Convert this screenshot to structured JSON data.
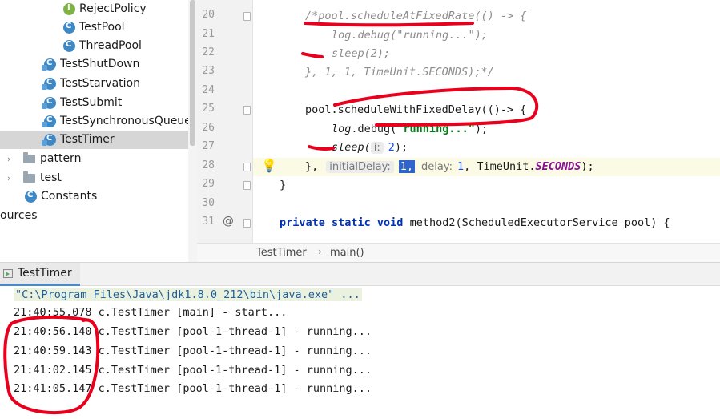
{
  "tree": {
    "items": [
      {
        "label": "RejectPolicy",
        "kind": "iface"
      },
      {
        "label": "TestPool",
        "kind": "class"
      },
      {
        "label": "ThreadPool",
        "kind": "class"
      },
      {
        "label": "TestShutDown",
        "kind": "class"
      },
      {
        "label": "TestStarvation",
        "kind": "class"
      },
      {
        "label": "TestSubmit",
        "kind": "class"
      },
      {
        "label": "TestSynchronousQueue",
        "kind": "class"
      },
      {
        "label": "TestTimer",
        "kind": "class",
        "selected": true
      },
      {
        "label": "pattern",
        "kind": "folder",
        "arrow": "›"
      },
      {
        "label": "test",
        "kind": "folder",
        "arrow": "›"
      },
      {
        "label": "Constants",
        "kind": "class"
      },
      {
        "label": "ources",
        "kind": "text"
      }
    ]
  },
  "editor": {
    "lines": [
      {
        "n": "20",
        "fold": true
      },
      {
        "n": "21"
      },
      {
        "n": "22"
      },
      {
        "n": "23"
      },
      {
        "n": "24"
      },
      {
        "n": "25",
        "fold": true
      },
      {
        "n": "26"
      },
      {
        "n": "27"
      },
      {
        "n": "28",
        "fold": true,
        "current": true,
        "bulb": true
      },
      {
        "n": "29",
        "fold": true
      },
      {
        "n": "30"
      },
      {
        "n": "31",
        "at": "@",
        "fold": true
      }
    ],
    "code": {
      "l20": "/*pool.scheduleAtFixedRate(() -> {",
      "l21": "log.debug(\"running...\");",
      "l22": "sleep(2);",
      "l23": "}, 1, 1, TimeUnit.SECONDS);*/",
      "l25": "pool.scheduleWithFixedDelay(()-> {",
      "l26_a": "log",
      "l26_b": ".debug(",
      "l26_c": "\"running...\"",
      "l26_d": ");",
      "l27_a": "sleep(",
      "l27_hint": "i:",
      "l27_num": "2",
      "l27_b": ");",
      "l28_a": "},",
      "l28_hint1": "initialDelay:",
      "l28_val1": "1,",
      "l28_hint2": "delay:",
      "l28_val2": "1",
      "l28_b": ", TimeUnit.",
      "l28_const": "SECONDS",
      "l28_c": ");",
      "l29": "}",
      "l31_kw": "private static void",
      "l31_rest": " method2(ScheduledExecutorService pool) {"
    }
  },
  "breadcrumb": {
    "class": "TestTimer",
    "sep": "›",
    "method": "main()"
  },
  "run": {
    "tab": "TestTimer",
    "cmd": "\"C:\\Program Files\\Java\\jdk1.8.0_212\\bin\\java.exe\" ...",
    "lines": [
      "21:40:55.078 c.TestTimer [main] - start...",
      "21:40:56.140 c.TestTimer [pool-1-thread-1] - running...",
      "21:40:59.143 c.TestTimer [pool-1-thread-1] - running...",
      "21:41:02.145 c.TestTimer [pool-1-thread-1] - running...",
      "21:41:05.147 c.TestTimer [pool-1-thread-1] - running..."
    ]
  },
  "colors": {
    "accent": "#4a88c7",
    "annotation": "#e8001c",
    "selection": "#2f65ca"
  }
}
